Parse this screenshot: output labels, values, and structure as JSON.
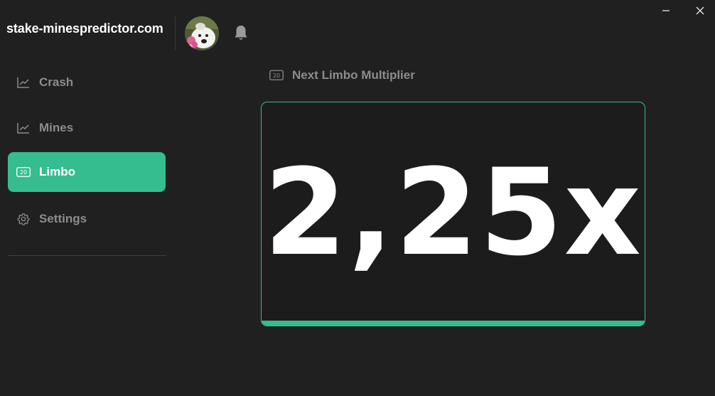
{
  "window": {
    "minimize_icon": "minimize-icon",
    "close_icon": "close-icon"
  },
  "header": {
    "site_title": "stake-minespredictor.com",
    "avatar_icon": "avatar",
    "bell_icon": "bell-icon"
  },
  "sidebar": {
    "items": [
      {
        "label": "Crash",
        "icon": "chart-line-icon",
        "active": false
      },
      {
        "label": "Mines",
        "icon": "chart-line-icon",
        "active": false
      },
      {
        "label": "Limbo",
        "icon": "limbo-20-icon",
        "icon_text": "20",
        "active": true
      },
      {
        "label": "Settings",
        "icon": "gear-icon",
        "active": false
      }
    ]
  },
  "main": {
    "section_title": "Next Limbo Multiplier",
    "section_icon_text": "20",
    "multiplier": "2,25x"
  },
  "colors": {
    "accent": "#36bd8f",
    "background": "#202020",
    "muted_text": "#8c8c8c",
    "text": "#ffffff"
  }
}
